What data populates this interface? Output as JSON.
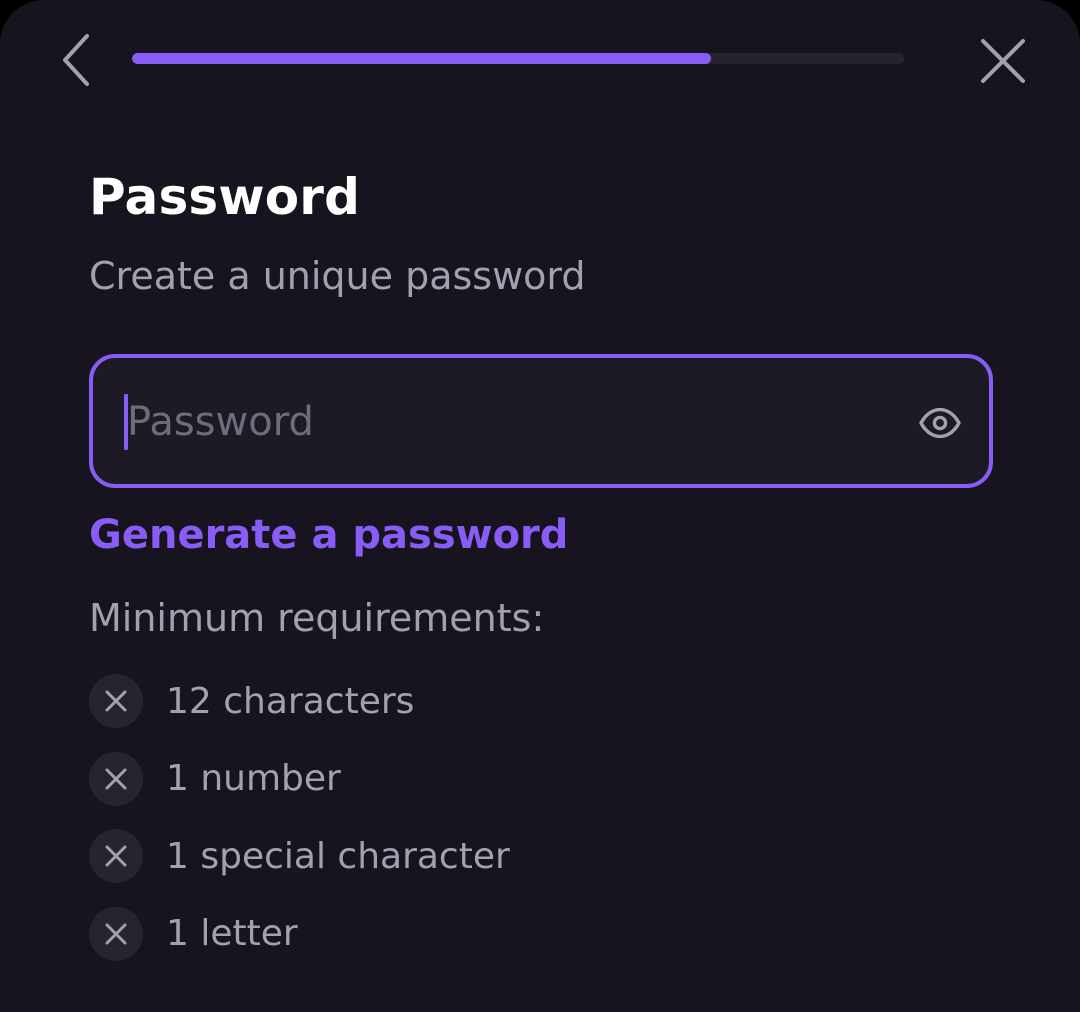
{
  "header": {
    "back_icon": "chevron-left-icon",
    "close_icon": "close-icon",
    "progress_fraction": 0.75
  },
  "title": "Password",
  "subtitle": "Create a unique password",
  "password_field": {
    "value": "",
    "placeholder": "Password",
    "toggle_icon": "eye-icon"
  },
  "generate_link": "Generate a password",
  "requirements": {
    "heading": "Minimum requirements:",
    "items": [
      {
        "label": "12 characters",
        "met": false,
        "icon": "x-icon"
      },
      {
        "label": "1 number",
        "met": false,
        "icon": "x-icon"
      },
      {
        "label": "1 special character",
        "met": false,
        "icon": "x-icon"
      },
      {
        "label": "1 letter",
        "met": false,
        "icon": "x-icon"
      }
    ]
  },
  "colors": {
    "background": "#17141f",
    "accent": "#8a5cf6",
    "text_primary": "#ffffff",
    "text_secondary": "#a3a0b0",
    "placeholder": "#6f6c7c"
  }
}
